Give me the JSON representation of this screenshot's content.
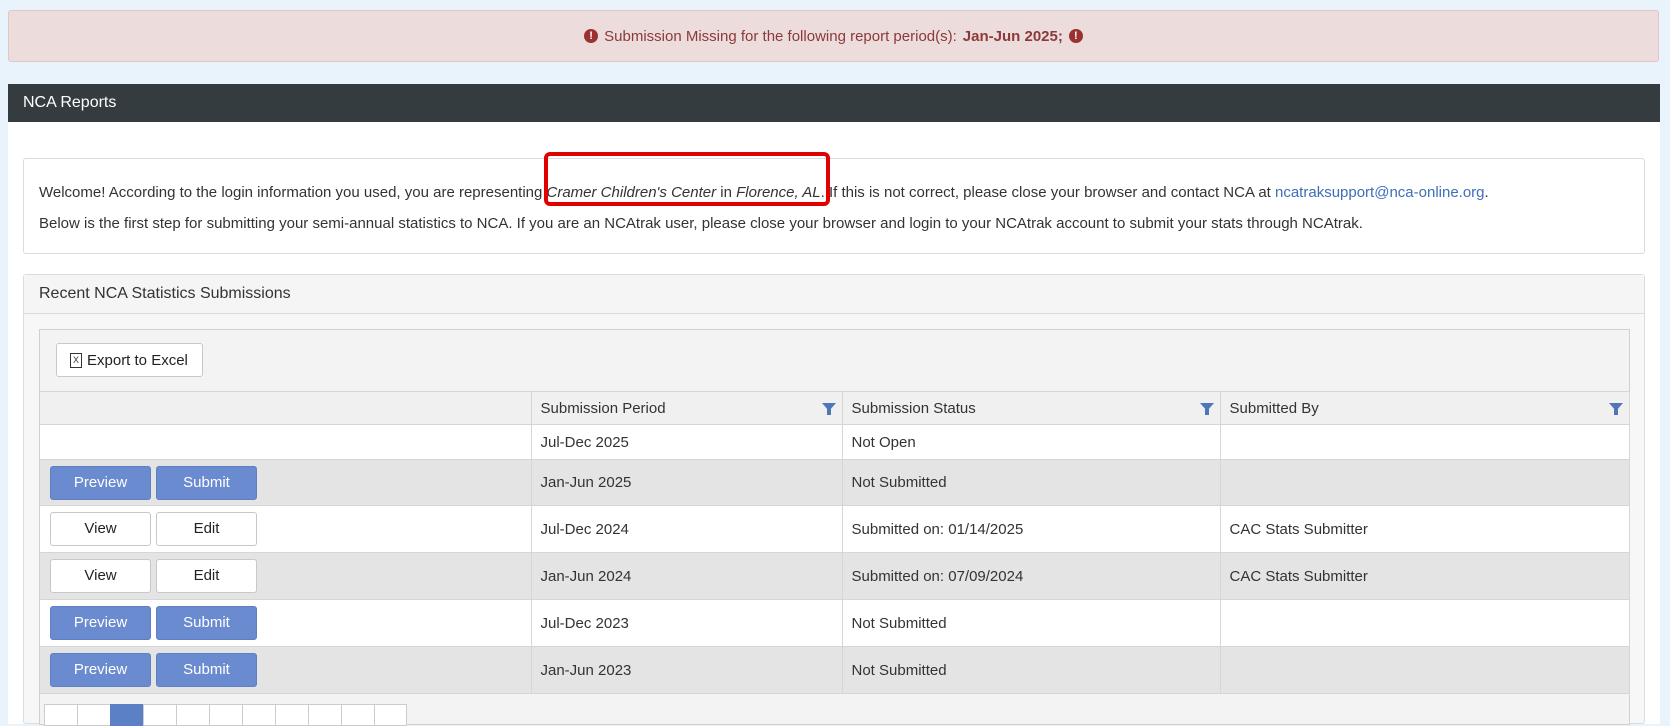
{
  "alert": {
    "prefix": "Submission Missing for the following report period(s):",
    "periods": "Jan-Jun 2025;",
    "icon": "exclamation-circle-icon"
  },
  "panel": {
    "title": "NCA Reports"
  },
  "welcome": {
    "line1_a": "Welcome! According to the login information you used, you are representing ",
    "center": "Cramer Children's Center",
    "in": " in ",
    "city": "Florence, AL",
    "line1_b": ". If this is not correct, please close your browser and contact NCA at ",
    "email": "ncatraksupport@nca-online.org",
    "line1_c": ".",
    "line2": "Below is the first step for submitting your semi-annual statistics to NCA. If you are an NCAtrak user, please close your browser and login to your NCAtrak account to submit your stats through NCAtrak."
  },
  "submissions": {
    "title": "Recent NCA Statistics Submissions",
    "export_label": "Export to Excel",
    "columns": [
      "",
      "Submission Period",
      "Submission Status",
      "Submitted By"
    ],
    "rows": [
      {
        "actions": [],
        "period": "Jul-Dec 2025",
        "status": "Not Open",
        "by": ""
      },
      {
        "actions": [
          "Preview",
          "Submit"
        ],
        "period": "Jan-Jun 2025",
        "status": "Not Submitted",
        "by": ""
      },
      {
        "actions": [
          "View",
          "Edit"
        ],
        "period": "Jul-Dec 2024",
        "status": "Submitted on: 01/14/2025",
        "by": "CAC Stats Submitter"
      },
      {
        "actions": [
          "View",
          "Edit"
        ],
        "period": "Jan-Jun 2024",
        "status": "Submitted on: 07/09/2024",
        "by": "CAC Stats Submitter"
      },
      {
        "actions": [
          "Preview",
          "Submit"
        ],
        "period": "Jul-Dec 2023",
        "status": "Not Submitted",
        "by": ""
      },
      {
        "actions": [
          "Preview",
          "Submit"
        ],
        "period": "Jan-Jun 2023",
        "status": "Not Submitted",
        "by": ""
      }
    ]
  },
  "colors": {
    "header_bg": "#353c40",
    "primary_button": "#6a8bcf",
    "alert_text": "#8b3a3a",
    "highlight_border": "#e00000"
  }
}
